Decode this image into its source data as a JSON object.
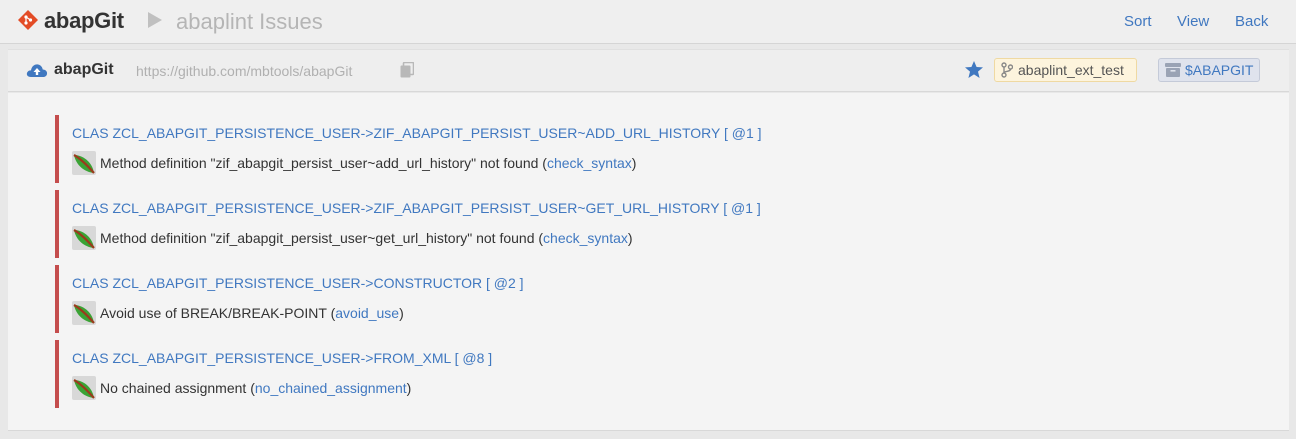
{
  "header": {
    "app_title": "abapGit",
    "page_title": "abaplint Issues",
    "menu": [
      "Sort",
      "View",
      "Back"
    ]
  },
  "repo": {
    "name": "abapGit",
    "url": "https://github.com/mbtools/abapGit",
    "branch": "abaplint_ext_test",
    "package": "$ABAPGIT"
  },
  "issues": [
    {
      "location": "CLAS ZCL_ABAPGIT_PERSISTENCE_USER->ZIF_ABAPGIT_PERSIST_USER~ADD_URL_HISTORY [ @1 ]",
      "message": "Method definition \"zif_abapgit_persist_user~add_url_history\" not found (",
      "rule": "check_syntax",
      "close": ")"
    },
    {
      "location": "CLAS ZCL_ABAPGIT_PERSISTENCE_USER->ZIF_ABAPGIT_PERSIST_USER~GET_URL_HISTORY [ @1 ]",
      "message": "Method definition \"zif_abapgit_persist_user~get_url_history\" not found (",
      "rule": "check_syntax",
      "close": ")"
    },
    {
      "location": "CLAS ZCL_ABAPGIT_PERSISTENCE_USER->CONSTRUCTOR [ @2 ]",
      "message": "Avoid use of BREAK/BREAK-POINT (",
      "rule": "avoid_use",
      "close": ")"
    },
    {
      "location": "CLAS ZCL_ABAPGIT_PERSISTENCE_USER->FROM_XML [ @8 ]",
      "message": "No chained assignment (",
      "rule": "no_chained_assignment",
      "close": ")"
    }
  ],
  "colors": {
    "link": "#4078c0",
    "error_border": "#c44d4d",
    "brand": "#e34c26"
  },
  "icons": {
    "logo": "git-diamond-icon",
    "repo": "cloud-upload-icon",
    "copy": "copy-icon",
    "favorite": "star-icon",
    "branch": "code-branch-icon",
    "package": "box-icon",
    "issue": "abaplint-leaf-icon"
  }
}
